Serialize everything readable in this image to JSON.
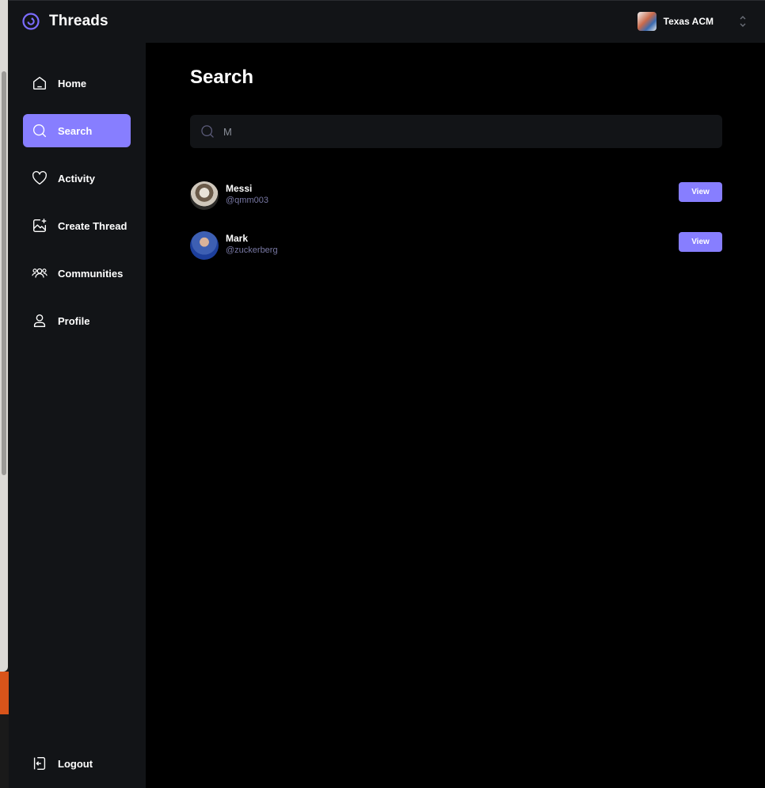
{
  "app": {
    "name": "Threads"
  },
  "org_switcher": {
    "name": "Texas ACM"
  },
  "sidebar": {
    "items": [
      {
        "label": "Home",
        "icon": "home-icon",
        "active": false
      },
      {
        "label": "Search",
        "icon": "search-icon",
        "active": true
      },
      {
        "label": "Activity",
        "icon": "heart-icon",
        "active": false
      },
      {
        "label": "Create Thread",
        "icon": "create-icon",
        "active": false
      },
      {
        "label": "Communities",
        "icon": "communities-icon",
        "active": false
      },
      {
        "label": "Profile",
        "icon": "user-icon",
        "active": false
      }
    ],
    "logout_label": "Logout"
  },
  "main": {
    "title": "Search",
    "search": {
      "value": "M",
      "placeholder": ""
    },
    "results": [
      {
        "name": "Messi",
        "handle": "@qmm003",
        "button_label": "View"
      },
      {
        "name": "Mark",
        "handle": "@zuckerberg",
        "button_label": "View"
      }
    ]
  },
  "colors": {
    "accent": "#877eff",
    "sidebar_bg": "#121417",
    "main_bg": "#000000",
    "handle": "#7878a3"
  }
}
